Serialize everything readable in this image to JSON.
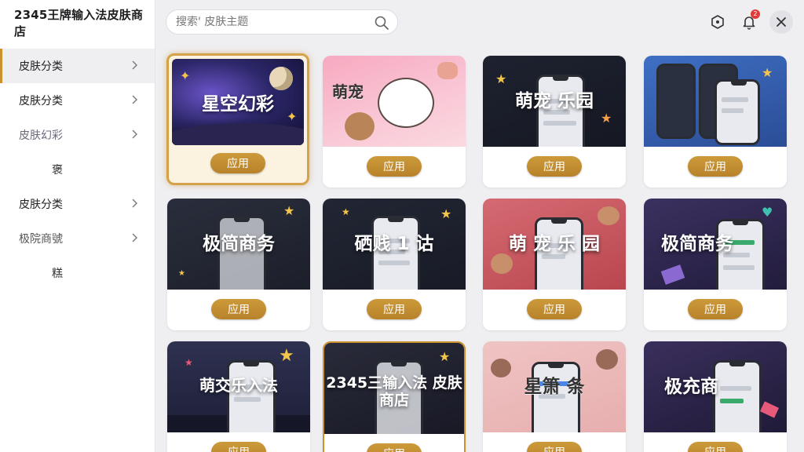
{
  "app": {
    "title": "2345王牌输入法皮肤商店"
  },
  "search": {
    "placeholder": "搜索' 皮肤主题"
  },
  "header": {
    "notification_count": "2"
  },
  "sidebar": {
    "items": [
      {
        "label": "皮肤分类"
      },
      {
        "label": "皮肤分类"
      },
      {
        "label": "皮肤幻彩"
      },
      {
        "label": "褒"
      },
      {
        "label": "皮肤分类"
      },
      {
        "label": "极院商號"
      },
      {
        "label": "糕"
      }
    ]
  },
  "apply_label": "应用",
  "cards": [
    {
      "title": "星空幻彩",
      "theme": "starry"
    },
    {
      "title": "萌宠",
      "theme": "cat"
    },
    {
      "title": "萌宠 乐园",
      "theme": "dark-phone"
    },
    {
      "title": "",
      "theme": "blue-phones"
    },
    {
      "title": "极简商务",
      "theme": "dark-phone"
    },
    {
      "title": "硒贱 1 诂",
      "theme": "dark-phone"
    },
    {
      "title": "萌 宠 乐 园",
      "theme": "red-pets"
    },
    {
      "title": "极简商务",
      "theme": "purple-phone"
    },
    {
      "title": "萌交乐入法",
      "theme": "city-night"
    },
    {
      "title": "2345三输入法 皮肤商店",
      "theme": "dark-gold"
    },
    {
      "title": "星箫 条",
      "theme": "pink-pets"
    },
    {
      "title": "极充商",
      "theme": "purple-phone"
    }
  ],
  "colors": {
    "accent": "#c9922c",
    "badge": "#e03a3a"
  }
}
